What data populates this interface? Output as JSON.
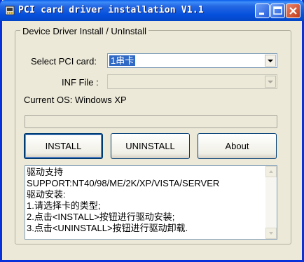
{
  "window": {
    "title": "PCI card driver installation V1.1",
    "icons": {
      "app": "pci-card-app-icon",
      "minimize": "minimize-icon",
      "maximize": "maximize-icon",
      "close": "close-icon"
    },
    "colors": {
      "titlebar": "#0550dc",
      "face": "#ece9d8",
      "selection": "#316ac5",
      "close": "#c33a16"
    }
  },
  "group": {
    "title": "Device Driver Install / UnInstall"
  },
  "select_card": {
    "label": "Select PCI card:",
    "value": "1串卡"
  },
  "inf_file": {
    "label": "INF File :",
    "value": ""
  },
  "os": {
    "text": "Current OS: Windows XP"
  },
  "progress": {
    "value": 0
  },
  "buttons": {
    "install": "INSTALL",
    "uninstall": "UNINSTALL",
    "about": "About"
  },
  "info": {
    "lines": [
      "驱动支持",
      "SUPPORT:NT40/98/ME/2K/XP/VISTA/SERVER",
      "驱动安装:",
      "1.请选择卡的类型;",
      "2.点击<INSTALL>按钮进行驱动安装;",
      "3.点击<UNINSTALL>按钮进行驱动卸载."
    ]
  }
}
